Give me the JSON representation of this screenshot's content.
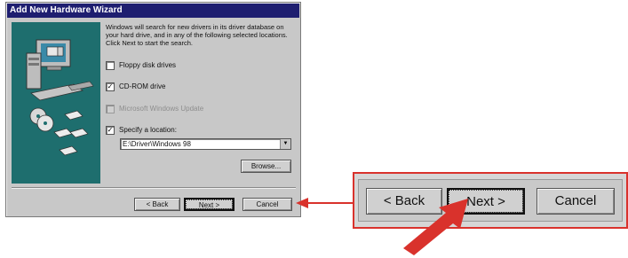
{
  "wizard": {
    "title": "Add New Hardware Wizard",
    "description": "Windows will search for new drivers in its driver database on your hard drive, and in any of the following selected locations. Click Next to start the search.",
    "options": [
      {
        "label": "Floppy disk drives",
        "checked": false,
        "enabled": true
      },
      {
        "label": "CD-ROM drive",
        "checked": true,
        "enabled": true
      },
      {
        "label": "Microsoft Windows Update",
        "checked": false,
        "enabled": false
      },
      {
        "label": "Specify a location:",
        "checked": true,
        "enabled": true
      }
    ],
    "location_value": "E:\\Driver\\Windows 98",
    "browse_label": "Browse...",
    "back_label": "< Back",
    "next_label": "Next >",
    "cancel_label": "Cancel"
  },
  "zoom": {
    "back_label": "< Back",
    "next_label": "Next >",
    "cancel_label": "Cancel"
  },
  "colors": {
    "titlebar": "#1e1e70",
    "art_background": "#1e6e6e",
    "annotation": "#d9322c"
  }
}
